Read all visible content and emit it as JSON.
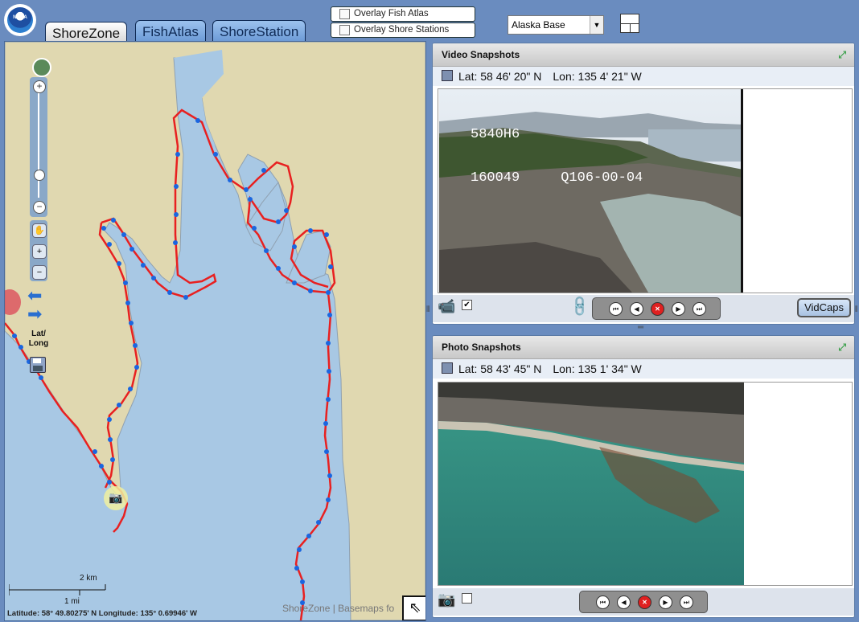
{
  "header": {
    "logo_text": "NOAA",
    "tabs": [
      {
        "label": "ShoreZone",
        "active": true
      },
      {
        "label": "FishAtlas",
        "active": false
      },
      {
        "label": "ShoreStation",
        "active": false
      }
    ],
    "overlays": [
      {
        "label": "Overlay Fish Atlas",
        "checked": false
      },
      {
        "label": "Overlay Shore Stations",
        "checked": false
      }
    ],
    "basemap_select": {
      "value": "Alaska Base"
    }
  },
  "map": {
    "controls": {
      "latlong_label": "Lat/ Long"
    },
    "scale": {
      "km": "2 km",
      "mi": "1 mi"
    },
    "coordinates": "Latitude: 58° 49.80275' N   Longitude: 135° 0.69946' W",
    "attribution": "ShoreZone | Basemaps fo",
    "colors": {
      "water": "#a8c8e4",
      "land": "#e0d8b0",
      "shore_track": "#e82020",
      "waypoint": "#1a66e0"
    }
  },
  "video_panel": {
    "title": "Video Snapshots",
    "lat": "Lat: 58 46' 20\" N",
    "lon": "Lon: 135 4' 21\" W",
    "overlay_text_line1": "5840H6",
    "overlay_text_line2": "160049     Q106-00-04",
    "vidcaps_label": "VidCaps",
    "checkbox_checked": true
  },
  "photo_panel": {
    "title": "Photo Snapshots",
    "lat": "Lat: 58 43' 45\" N",
    "lon": "Lon: 135 1' 34\" W",
    "checkbox_checked": false
  },
  "icons": {
    "globe": "globe-icon",
    "pan": "hand-icon",
    "zoom_in": "magnify-plus-icon",
    "zoom_out": "magnify-minus-icon",
    "prev_extent": "arrow-left-icon",
    "next_extent": "arrow-right-icon",
    "save": "floppy-disk-icon",
    "camera": "camera-icon",
    "maximize": "maximize-icon",
    "link": "link-icon",
    "collapse": "arrow-up-left-icon"
  }
}
